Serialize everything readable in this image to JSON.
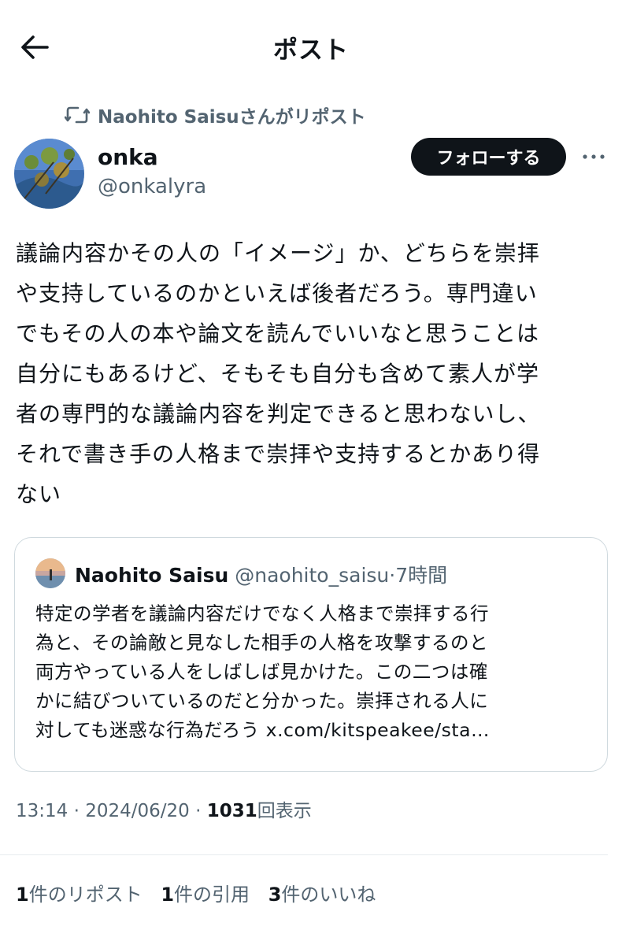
{
  "header": {
    "title": "ポスト",
    "back_icon": "arrow-left-icon"
  },
  "repost": {
    "text": "Naohito Saisuさんがリポスト",
    "icon": "repost-icon"
  },
  "author": {
    "display_name": "onka",
    "handle": "@onkalyra",
    "follow_label": "フォローする",
    "more_icon": "more-horizontal-icon"
  },
  "post": {
    "lines": [
      "議論内容かその人の「イメージ」か、どちらを崇拝",
      "や支持しているのかといえば後者だろう。専門違い",
      "でもその人の本や論文を読んでいいなと思うことは",
      "自分にもあるけど、そもそも自分も含めて素人が学",
      "者の専門的な議論内容を判定できると思わないし、",
      "それで書き手の人格まで崇拝や支持するとかあり得",
      "ない"
    ]
  },
  "quote": {
    "name": "Naohito Saisu",
    "handle": "@naohito_saisu",
    "separator": "·",
    "time": "7時間",
    "lines": [
      "特定の学者を議論内容だけでなく人格まで崇拝する行",
      "為と、その論敵と見なした相手の人格を攻撃するのと",
      "両方やっている人をしばしば見かけた。この二つは確",
      "かに結びついているのだと分かった。崇拝される人に",
      "対しても迷惑な行為だろう x.com/kitspeakee/sta…"
    ]
  },
  "meta": {
    "time": "13:14",
    "sep1": " · ",
    "date": "2024/06/20",
    "sep2": " · ",
    "views_count": "1031",
    "views_label": "回表示"
  },
  "stats": {
    "reposts_count": "1",
    "reposts_label": "件のリポスト",
    "quotes_count": "1",
    "quotes_label": "件の引用",
    "likes_count": "3",
    "likes_label": "件のいいね"
  },
  "colors": {
    "text": "#0f1419",
    "secondary": "#536471",
    "border": "#cfd9de",
    "button_bg": "#0f1419"
  }
}
